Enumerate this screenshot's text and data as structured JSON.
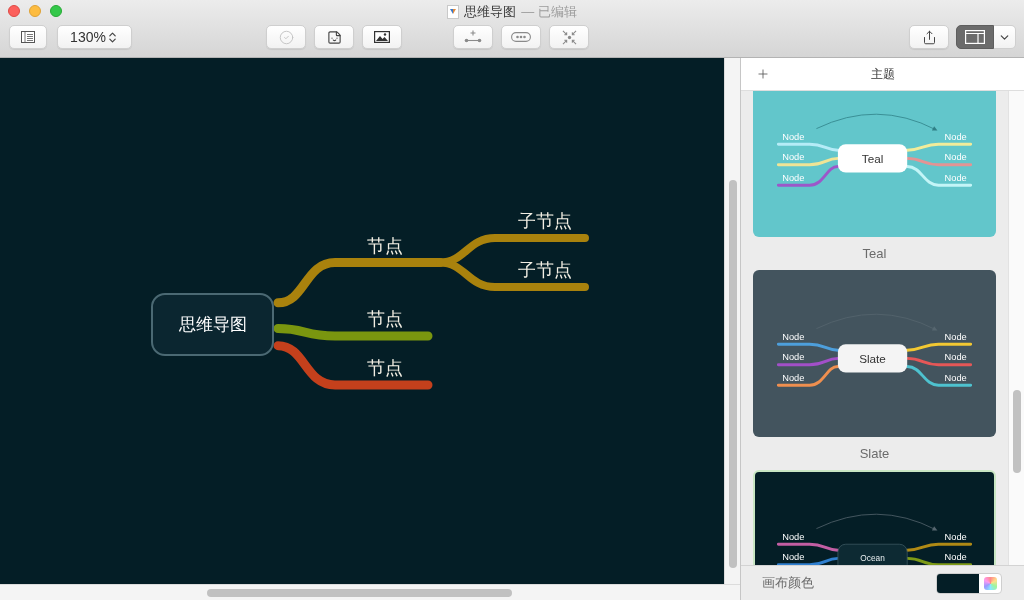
{
  "window": {
    "title": "思维导图",
    "status": "— 已编辑"
  },
  "toolbar": {
    "zoom": "130%",
    "complete_button": {
      "disabled": true
    },
    "inspector_toggle": {
      "on": true
    }
  },
  "mind_map": {
    "root": {
      "text": "思维导图",
      "children": [
        {
          "text": "节点",
          "color": "#a9820d",
          "children": [
            {
              "text": "子节点"
            },
            {
              "text": "子节点"
            }
          ]
        },
        {
          "text": "节点",
          "color": "#7a960f"
        },
        {
          "text": "节点",
          "color": "#c4401c"
        }
      ]
    }
  },
  "inspector": {
    "title": "主题",
    "themes": [
      {
        "name": "Teal",
        "selected": false,
        "color": "#62c6cb",
        "center": {
          "text": "Teal",
          "color": "#ffffff"
        },
        "left": [
          {
            "text": "Node",
            "color": "#b5ecf7"
          },
          {
            "text": "Node",
            "color": "#efe495"
          },
          {
            "text": "Node",
            "color": "#9c58c9"
          }
        ],
        "right": [
          {
            "text": "Node",
            "color": "#f2ec9a"
          },
          {
            "text": "Node",
            "color": "#e39494"
          },
          {
            "text": "Node",
            "color": "#c3f5f7"
          }
        ]
      },
      {
        "name": "Slate",
        "selected": false,
        "color": "#43545e",
        "center": {
          "text": "Slate",
          "color": "#f4f4f4"
        },
        "left": [
          {
            "text": "Node",
            "color": "#4d9fdc"
          },
          {
            "text": "Node",
            "color": "#a24fc8"
          },
          {
            "text": "Node",
            "color": "#ef8f4f"
          }
        ],
        "right": [
          {
            "text": "Node",
            "color": "#f2c832"
          },
          {
            "text": "Node",
            "color": "#e55757"
          },
          {
            "text": "Node",
            "color": "#4ec2cf"
          }
        ]
      },
      {
        "selected": true,
        "color": "#041e26",
        "center": {
          "text": "Ocean",
          "color": "#0d2a33"
        },
        "left": [
          {
            "text": "Node",
            "color": "#c35ea3"
          },
          {
            "text": "Node",
            "color": "#2f7fcf"
          }
        ],
        "right": [
          {
            "text": "Node",
            "color": "#b08a15"
          },
          {
            "text": "Node",
            "color": "#7d9a16"
          }
        ]
      }
    ],
    "canvas_color": {
      "label": "画布颜色",
      "color": "#041e26"
    }
  }
}
